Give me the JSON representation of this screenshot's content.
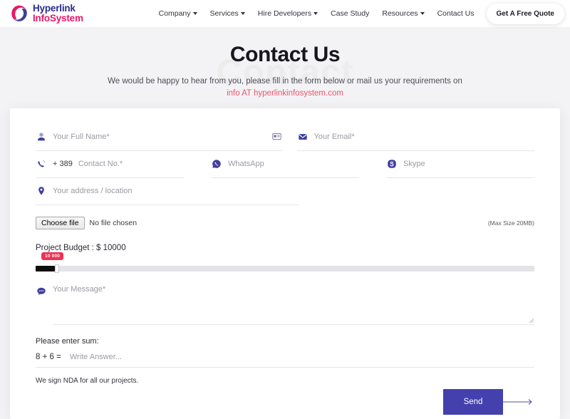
{
  "header": {
    "logo": {
      "line1": "Hyperlink",
      "line2": "InfoSystem",
      "icon": "hyperlink-logo-icon"
    },
    "nav": [
      {
        "label": "Company",
        "has_caret": true
      },
      {
        "label": "Services",
        "has_caret": true
      },
      {
        "label": "Hire Developers",
        "has_caret": true
      },
      {
        "label": "Case Study",
        "has_caret": false
      },
      {
        "label": "Resources",
        "has_caret": true
      },
      {
        "label": "Contact Us",
        "has_caret": false
      }
    ],
    "cta_label": "Get A Free Quote"
  },
  "hero": {
    "watermark": "Contact",
    "title": "Contact Us",
    "subtitle": "We would be happy to hear from you, please fill in the form below or mail us your requirements on",
    "email": "info AT hyperlinkinfosystem.com"
  },
  "form": {
    "full_name": {
      "placeholder": "Your Full Name*",
      "value": "",
      "icon": "user-icon",
      "trailing_icon": "contact-card-icon"
    },
    "email": {
      "placeholder": "Your Email*",
      "value": "",
      "icon": "envelope-icon"
    },
    "country_code": "+ 389",
    "contact_no": {
      "placeholder": "Contact No.*",
      "value": "",
      "icon": "phone-icon"
    },
    "whatsapp": {
      "placeholder": "WhatsApp",
      "value": "",
      "icon": "whatsapp-icon"
    },
    "skype": {
      "placeholder": "Skype",
      "value": "",
      "icon": "skype-icon"
    },
    "address": {
      "placeholder": "Your address / location",
      "value": "",
      "icon": "location-pin-icon"
    },
    "file": {
      "button_label": "Choose file",
      "status": "No file chosen",
      "max_size_note": "(Max Size 20MB)"
    },
    "budget": {
      "label": "Project Budget : $ 10000",
      "badge": "10 000",
      "value": 10000,
      "min": 0,
      "max": 250000
    },
    "message": {
      "placeholder": "Your Message*",
      "value": "",
      "icon": "chat-bubble-icon"
    },
    "captcha": {
      "label": "Please enter sum:",
      "equation": "8 + 6 =",
      "placeholder": "Write Answer...",
      "value": ""
    },
    "nda_note": "We sign NDA for all our projects.",
    "send_label": "Send"
  },
  "colors": {
    "brand_purple": "#2b2b8f",
    "brand_pink": "#e8176b",
    "accent_red": "#ec5569",
    "icon_purple": "#4440ad",
    "button_purple": "#4440ad",
    "page_bg": "#f3f3f6"
  }
}
